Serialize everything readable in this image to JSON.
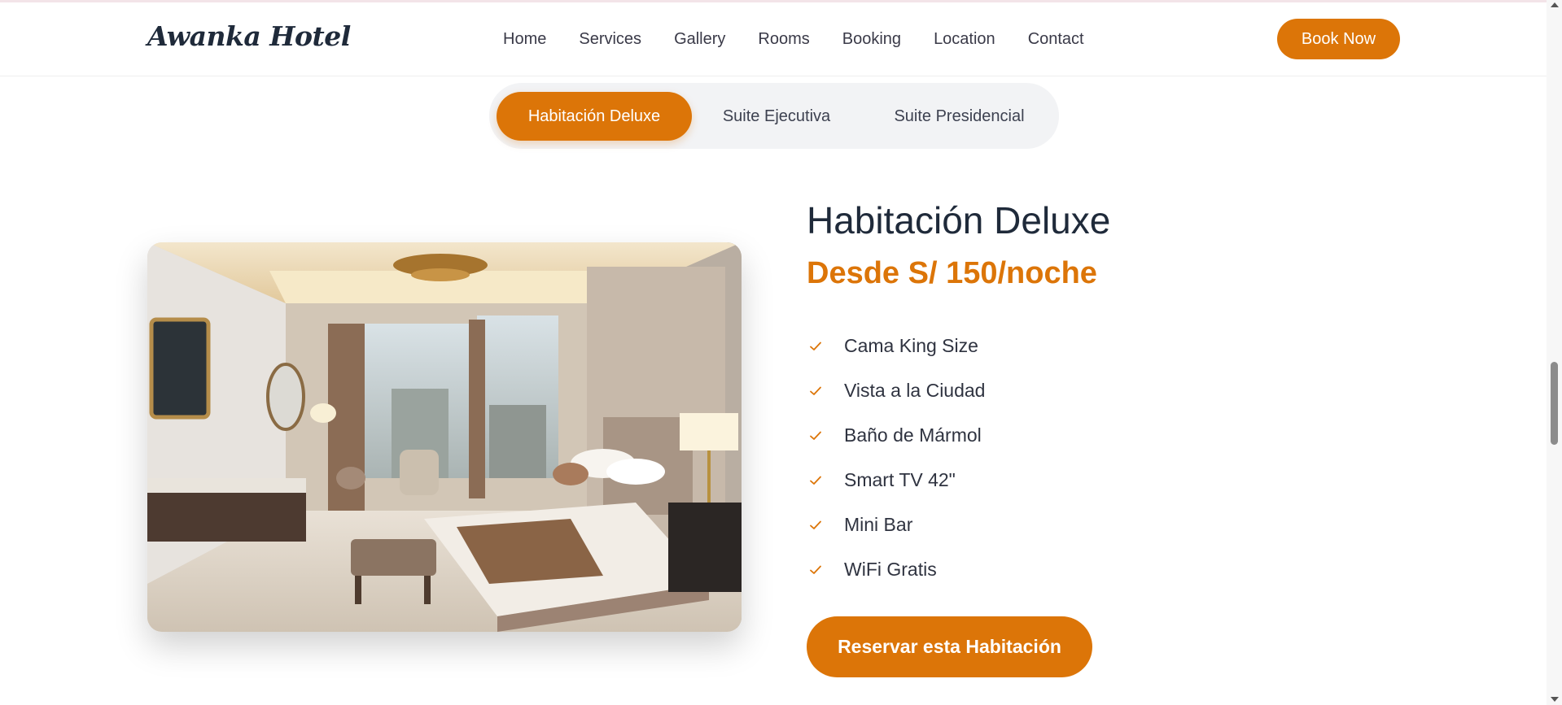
{
  "header": {
    "logo": "Awanka Hotel",
    "nav": [
      "Home",
      "Services",
      "Gallery",
      "Rooms",
      "Booking",
      "Location",
      "Contact"
    ],
    "cta": "Book Now"
  },
  "room_tabs": {
    "items": [
      "Habitación Deluxe",
      "Suite Ejecutiva",
      "Suite Presidencial"
    ],
    "active": "Habitación Deluxe"
  },
  "room": {
    "title": "Habitación Deluxe",
    "price": "Desde S/ 150/noche",
    "features": [
      "Cama King Size",
      "Vista a la Ciudad",
      "Baño de Mármol",
      "Smart TV 42\"",
      "Mini Bar",
      "WiFi Gratis"
    ],
    "reserve_label": "Reservar esta Habitación",
    "image_icon": "hotel-room-photo"
  },
  "colors": {
    "accent": "#dc7508",
    "heading": "#1f2a3a",
    "tab_bg": "#f2f3f5"
  }
}
